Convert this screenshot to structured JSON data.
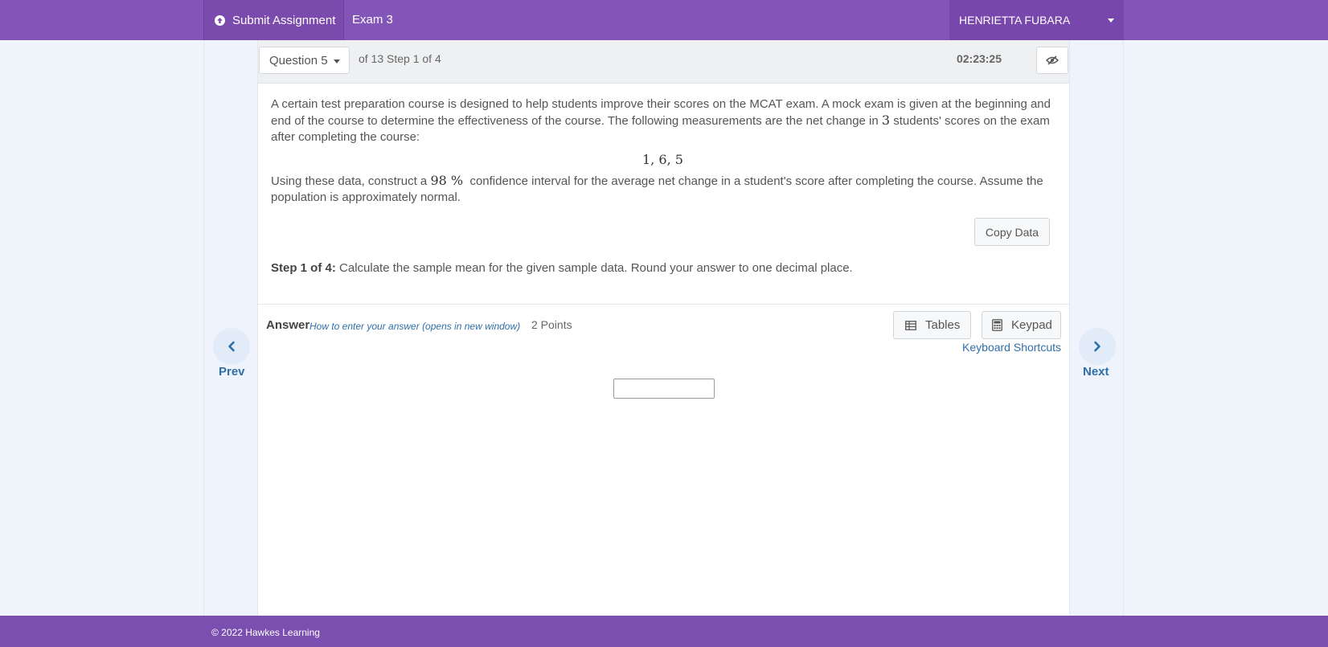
{
  "header": {
    "submit_label": "Submit Assignment",
    "exam_title": "Exam 3",
    "user_name": "HENRIETTA FUBARA"
  },
  "question_bar": {
    "question_select": "Question 5",
    "of_text": "of 13 Step 1 of 4",
    "timer": "02:23:25"
  },
  "problem": {
    "text_part1": "A certain test preparation course is designed to help students improve their scores on the MCAT exam. A mock exam is given at the beginning and end of the course to determine the effectiveness of the course. The following measurements are the net change in ",
    "n": "3",
    "text_part2": " students' scores on the exam after completing the course:",
    "data": "1, 6, 5",
    "instr_part1": "Using these data, construct a ",
    "confidence": "98 %",
    "instr_part2": " confidence interval for the average net change in a student's score after completing the course. Assume the population is approximately normal.",
    "copy_label": "Copy Data",
    "step_label": "Step 1 of 4:",
    "step_text": " Calculate the sample mean for the given sample data. Round your answer to one decimal place."
  },
  "answer": {
    "label": "Answer",
    "howto_link": "How to enter your answer (opens in new window)",
    "points": "2 Points",
    "tables_label": "Tables",
    "keypad_label": "Keypad",
    "shortcuts_label": "Keyboard Shortcuts",
    "input_value": ""
  },
  "nav": {
    "prev_label": "Prev",
    "next_label": "Next"
  },
  "footer": {
    "copyright": "© 2022 Hawkes Learning"
  },
  "colors": {
    "header": "#8455b8",
    "footer": "#7a4fb0",
    "link": "#2f6fa8"
  }
}
